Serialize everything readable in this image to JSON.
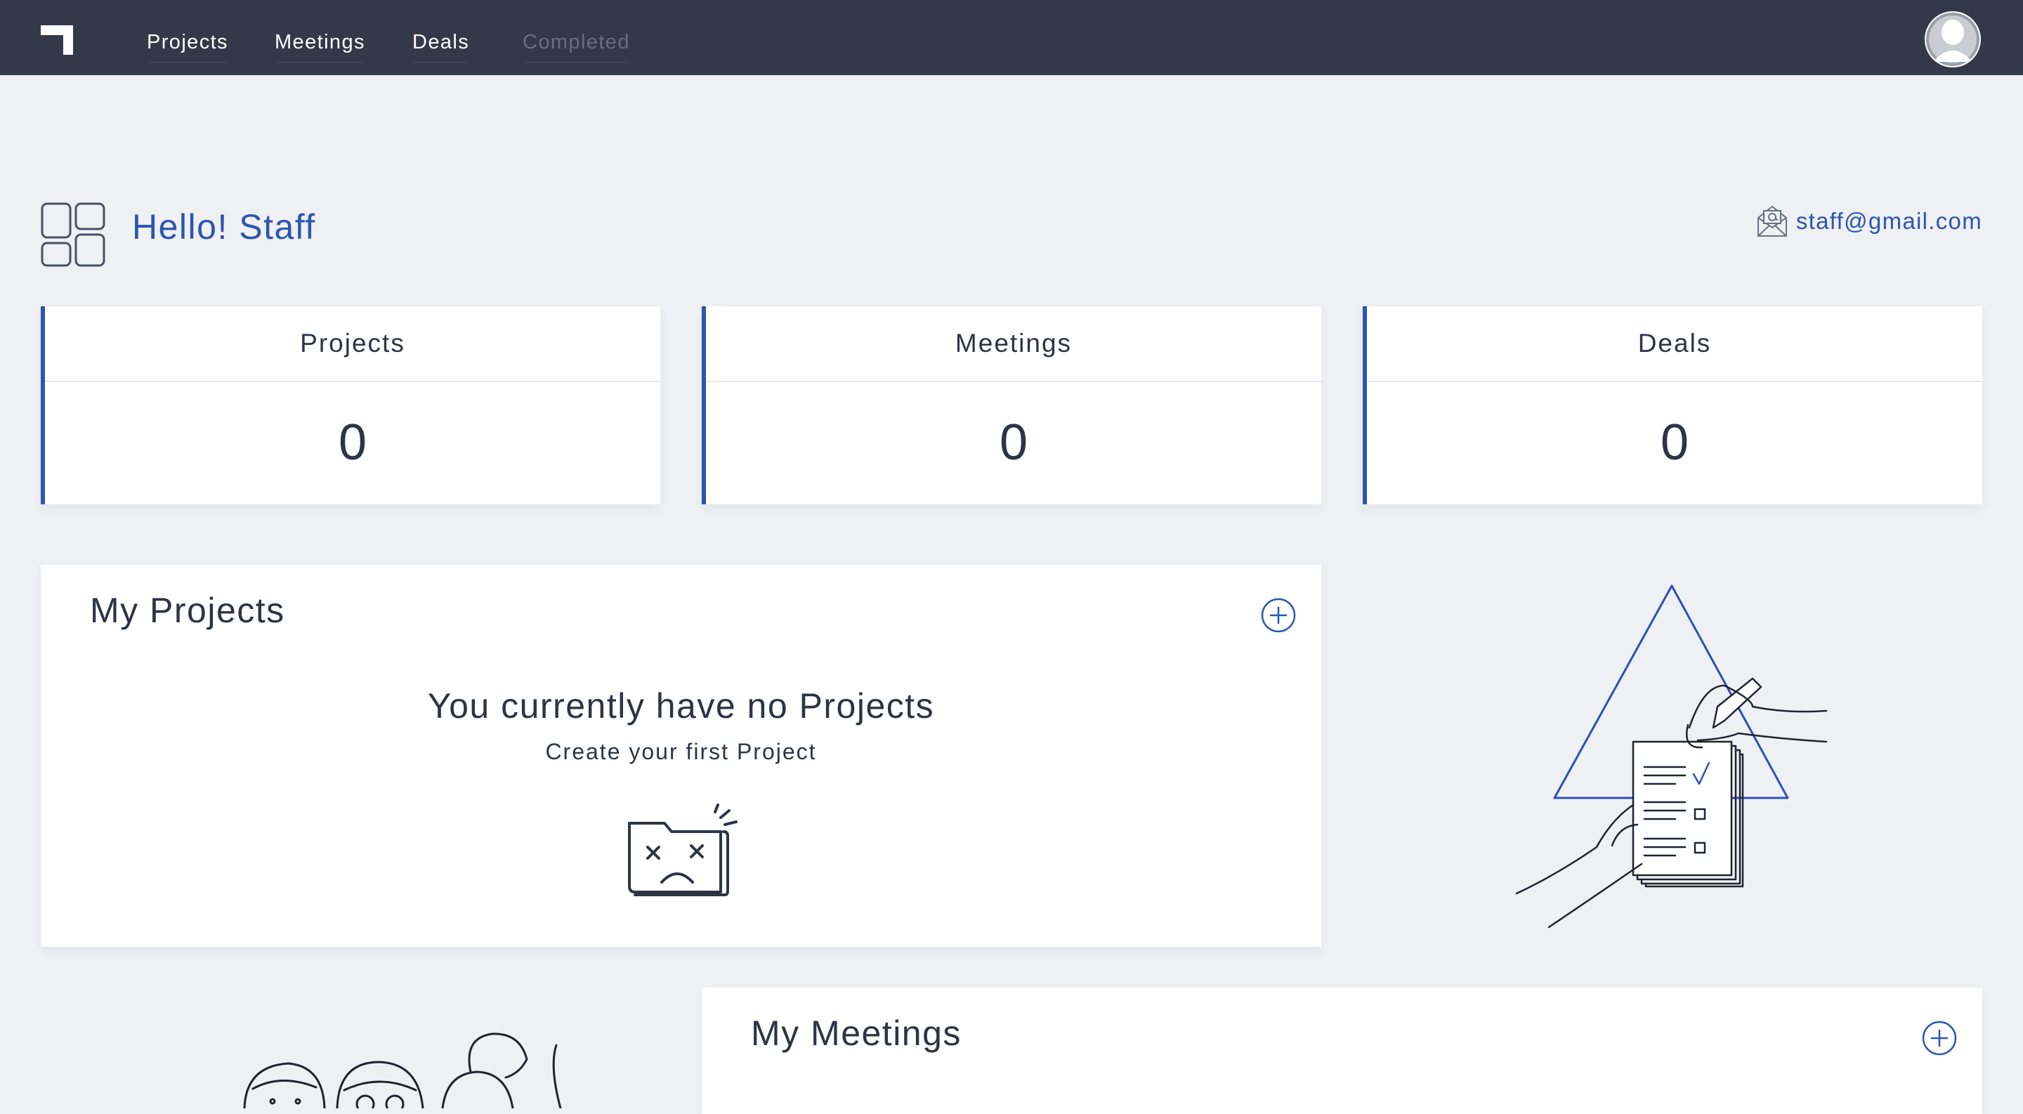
{
  "nav": {
    "items": [
      {
        "label": "Projects",
        "state": "default"
      },
      {
        "label": "Meetings",
        "state": "default"
      },
      {
        "label": "Deals",
        "state": "default"
      },
      {
        "label": "Completed",
        "state": "disabled"
      }
    ]
  },
  "greeting": {
    "text": "Hello! Staff",
    "icon": "dashboard-grid-icon"
  },
  "user": {
    "email": "staff@gmail.com",
    "email_icon": "mail-at-icon"
  },
  "stats": [
    {
      "label": "Projects",
      "value": "0"
    },
    {
      "label": "Meetings",
      "value": "0"
    },
    {
      "label": "Deals",
      "value": "0"
    }
  ],
  "projects_panel": {
    "title": "My Projects",
    "empty_title": "You currently have no Projects",
    "empty_subtitle": "Create your first Project"
  },
  "meetings_panel": {
    "title": "My Meetings"
  },
  "colors": {
    "navbar": "#333949",
    "accent": "#2c55b0",
    "background": "#eff0f4",
    "text": "#2e3446"
  }
}
